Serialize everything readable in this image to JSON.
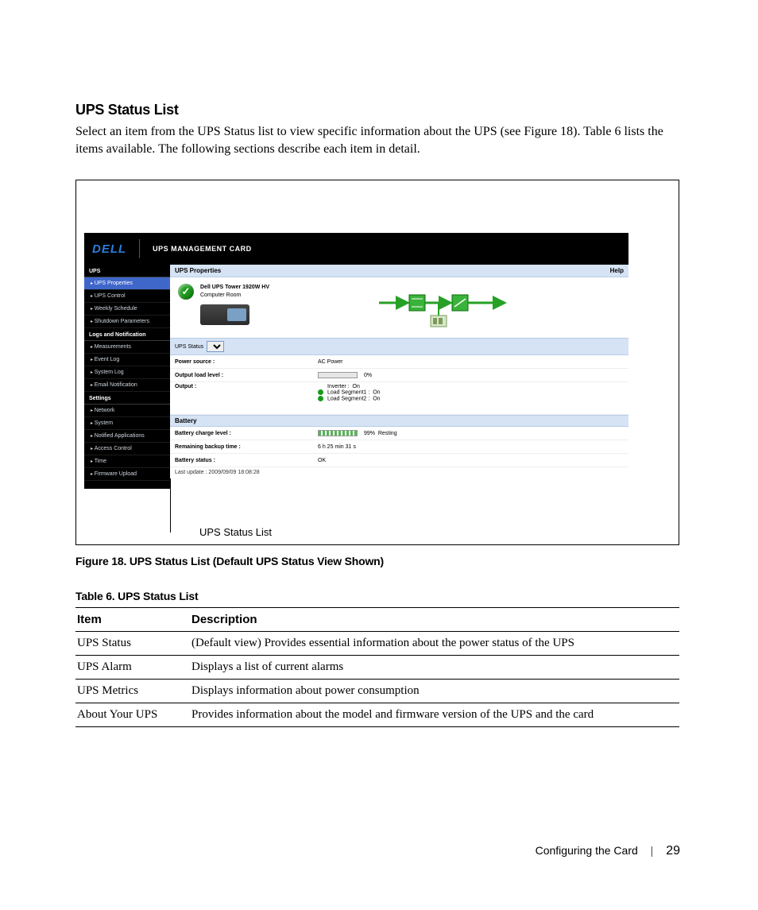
{
  "heading": "UPS Status List",
  "intro": "Select an item from the UPS Status list to view specific information about the UPS (see Figure 18). Table 6 lists the items available. The following sections describe each item in detail.",
  "fig_caption": "Figure 18. UPS Status List (Default UPS Status View Shown)",
  "callout_label": "UPS Status List",
  "app": {
    "brand": "DELL",
    "title": "UPS MANAGEMENT CARD",
    "panel_title": "UPS Properties",
    "help": "Help",
    "device_name": "Dell UPS Tower 1920W HV",
    "device_room": "Computer Room",
    "picker_label": "UPS Status",
    "rows": {
      "power_source": {
        "k": "Power source :",
        "v": "AC Power"
      },
      "output_load": {
        "k": "Output load level :",
        "pct": "0%"
      },
      "output": {
        "k": "Output :",
        "inverter": {
          "k": "Inverter :",
          "v": "On"
        },
        "seg1": {
          "k": "Load Segment1 :",
          "v": "On"
        },
        "seg2": {
          "k": "Load Segment2 :",
          "v": "On"
        }
      },
      "battery_header": "Battery",
      "batt_charge": {
        "k": "Battery charge level :",
        "pct": "99%",
        "state": "Resting"
      },
      "backup_time": {
        "k": "Remaining backup time :",
        "v": "6 h 25 min 31 s"
      },
      "batt_status": {
        "k": "Battery status :",
        "v": "OK"
      },
      "last_update": "Last update : 2009/09/09 18:08:28"
    },
    "nav": {
      "groups": [
        {
          "title": "UPS",
          "items": [
            "UPS Properties",
            "UPS Control",
            "Weekly Schedule",
            "Shutdown Parameters"
          ],
          "selected": 0
        },
        {
          "title": "Logs and Notification",
          "items": [
            "Measurements",
            "Event Log",
            "System Log",
            "Email Notification"
          ]
        },
        {
          "title": "Settings",
          "items": [
            "Network",
            "System",
            "Notified Applications",
            "Access Control",
            "Time",
            "Firmware Upload"
          ]
        }
      ]
    }
  },
  "table": {
    "caption": "Table 6. UPS Status List",
    "head": {
      "item": "Item",
      "desc": "Description"
    },
    "rows": [
      {
        "item": "UPS Status",
        "desc": "(Default view) Provides essential information about the power status of the UPS"
      },
      {
        "item": "UPS Alarm",
        "desc": "Displays a list of current alarms"
      },
      {
        "item": "UPS Metrics",
        "desc": "Displays information about power consumption"
      },
      {
        "item": "About Your UPS",
        "desc": "Provides information about the model and firmware version of the UPS and the card"
      }
    ]
  },
  "footer": {
    "section": "Configuring the Card",
    "page": "29"
  }
}
